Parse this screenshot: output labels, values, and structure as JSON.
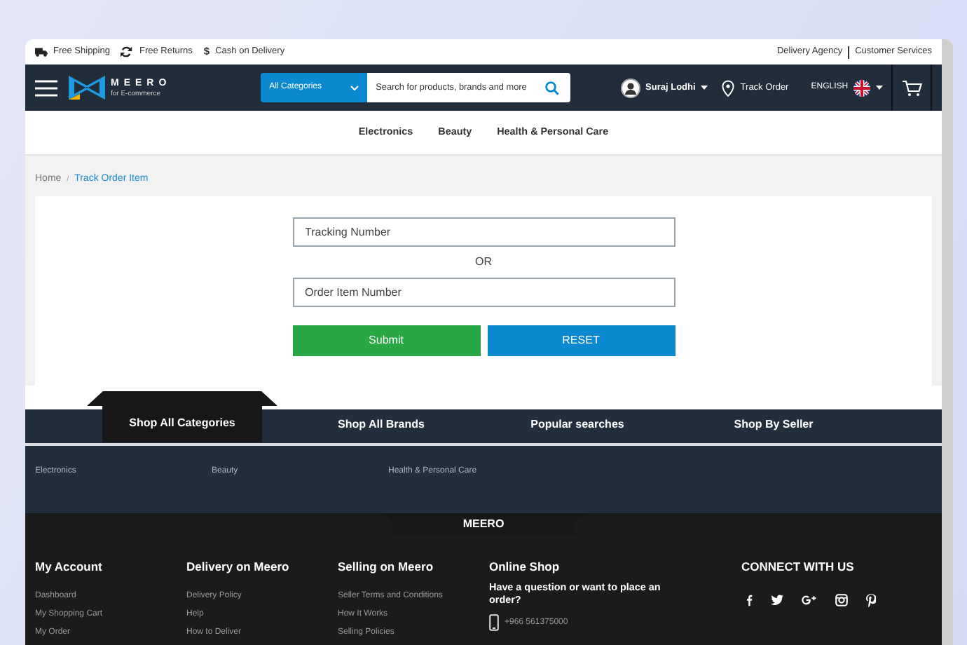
{
  "topbar": {
    "features": [
      {
        "label": "Free Shipping"
      },
      {
        "label": "Free Returns"
      },
      {
        "label": "Cash on Delivery",
        "icon_text": "$"
      }
    ],
    "links": [
      "Delivery Agency",
      "Customer Services"
    ]
  },
  "header": {
    "logo": {
      "name": "MEERO",
      "tagline": "for E-commerce"
    },
    "search": {
      "category": "All Categories",
      "placeholder": "Search for products, brands and more"
    },
    "user": "Suraj Lodhi",
    "track_order": "Track Order",
    "language": "ENGLISH"
  },
  "category_nav": [
    "Electronics",
    "Beauty",
    "Health & Personal Care"
  ],
  "breadcrumb_separator": "/",
  "breadcrumb": [
    {
      "label": "Home",
      "selected": false
    },
    {
      "label": "Track Order Item",
      "selected": true
    }
  ],
  "form": {
    "fields": [
      {
        "placeholder": "Tracking Number"
      },
      {
        "placeholder": "Order Item Number"
      }
    ],
    "separator": "OR",
    "buttons": [
      {
        "label": "Submit",
        "kind": "submit"
      },
      {
        "label": "RESET",
        "kind": "reset"
      }
    ]
  },
  "footer_tabs": [
    {
      "label": "Shop All Categories",
      "selected": true
    },
    {
      "label": "Shop All Brands",
      "selected": false
    },
    {
      "label": "Popular searches",
      "selected": false
    },
    {
      "label": "Shop By Seller",
      "selected": false
    }
  ],
  "category_links": [
    "Electronics",
    "Beauty",
    "Health & Personal Care"
  ],
  "footer": {
    "brand": "MEERO",
    "columns": [
      {
        "title": "My Account",
        "links": [
          "Dashboard",
          "My Shopping Cart",
          "My Order"
        ]
      },
      {
        "title": "Delivery on Meero",
        "links": [
          "Delivery Policy",
          "Help",
          "How to Deliver"
        ]
      },
      {
        "title": "Selling on Meero",
        "links": [
          "Seller Terms and Conditions",
          "How It Works",
          "Selling Policies"
        ]
      }
    ],
    "online_shop": {
      "title": "Online Shop",
      "question": "Have a question or want to place an order?",
      "phone": "+966 561375000"
    },
    "connect": {
      "title": "CONNECT WITH US"
    }
  }
}
